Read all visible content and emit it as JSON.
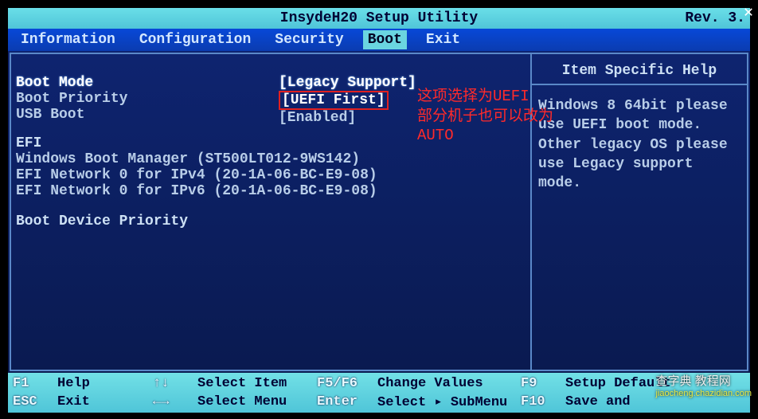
{
  "title": "InsydeH20 Setup Utility",
  "revision": "Rev. 3.",
  "tabs": {
    "information": "Information",
    "configuration": "Configuration",
    "security": "Security",
    "boot": "Boot",
    "exit": "Exit"
  },
  "boot": {
    "mode_label": "Boot Mode",
    "mode_value": "[Legacy Support]",
    "priority_label": "Boot Priority",
    "priority_value": "[UEFI First]",
    "usb_label": "USB Boot",
    "usb_value": "[Enabled]",
    "efi_header": "EFI",
    "efi_items": {
      "wbm": "Windows Boot Manager (ST500LT012-9WS142)",
      "ipv4": "EFI Network 0 for IPv4 (20-1A-06-BC-E9-08)",
      "ipv6": "EFI Network 0 for IPv6 (20-1A-06-BC-E9-08)"
    },
    "device_priority_label": "Boot Device Priority"
  },
  "help": {
    "title": "Item Specific Help",
    "body": "Windows 8 64bit please use UEFI boot mode. Other legacy OS please use Legacy support mode."
  },
  "annotation": "这项选择为UEFI\n部分机子也可以改为\nAUTO",
  "footer": {
    "f1_key": "F1",
    "f1_lbl": "Help",
    "esc_key": "ESC",
    "esc_lbl": "Exit",
    "arrows_key": "↑↓",
    "arrows_lbl": "Select Item",
    "lr_key": "←→",
    "lr_lbl": "Select Menu",
    "f5f6_key": "F5/F6",
    "f5f6_lbl": "Change Values",
    "enter_key": "Enter",
    "enter_lbl": "Select ▸ SubMenu",
    "f9_key": "F9",
    "f9_lbl": "Setup Default",
    "f10_key": "F10",
    "f10_lbl": "Save and"
  },
  "watermark": {
    "main": "查字典 教程网",
    "sub": "jiaocheng.chazidian.com"
  },
  "close": "✕"
}
